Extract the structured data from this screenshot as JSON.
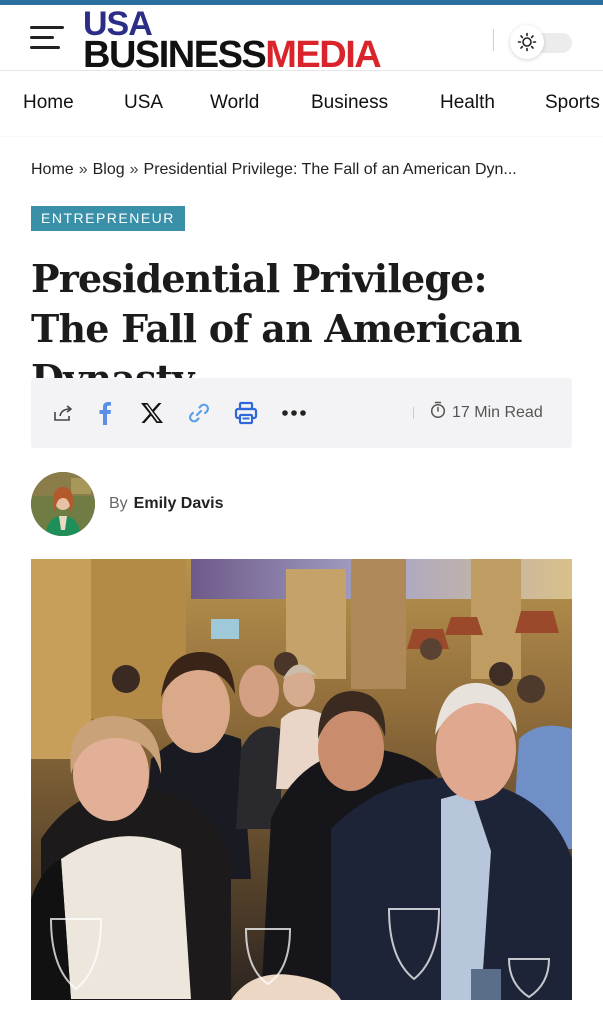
{
  "site": {
    "logo_top": "USA",
    "logo_business": "BUSINESS",
    "logo_media": "MEDIA",
    "brand_colors": {
      "blue": "#2c2d86",
      "red": "#d9242b",
      "accent_bar": "#2b6f9e"
    }
  },
  "header": {
    "menu_icon": "hamburger-menu-icon",
    "theme_icon": "sun-icon"
  },
  "nav": {
    "items": [
      {
        "label": "Home"
      },
      {
        "label": "USA"
      },
      {
        "label": "World"
      },
      {
        "label": "Business"
      },
      {
        "label": "Health"
      },
      {
        "label": "Sports"
      }
    ]
  },
  "breadcrumb": {
    "items": [
      "Home",
      "Blog",
      "Presidential Privilege: The Fall of an American Dyn..."
    ],
    "separator": "»"
  },
  "article": {
    "category": "ENTREPRENEUR",
    "category_color": "#3a90a8",
    "title": "Presidential Privilege: The Fall of an American Dynasty",
    "read_time": "17 Min Read",
    "author_prefix": "By",
    "author_name": "Emily Davis"
  },
  "share": {
    "icons": [
      "share-icon",
      "facebook-icon",
      "x-icon",
      "copy-link-icon",
      "print-icon",
      "more-icon"
    ],
    "colors": {
      "facebook": "#5b8ee6",
      "x": "#111111",
      "link": "#5ba0e6",
      "print": "#2f68d8"
    }
  }
}
